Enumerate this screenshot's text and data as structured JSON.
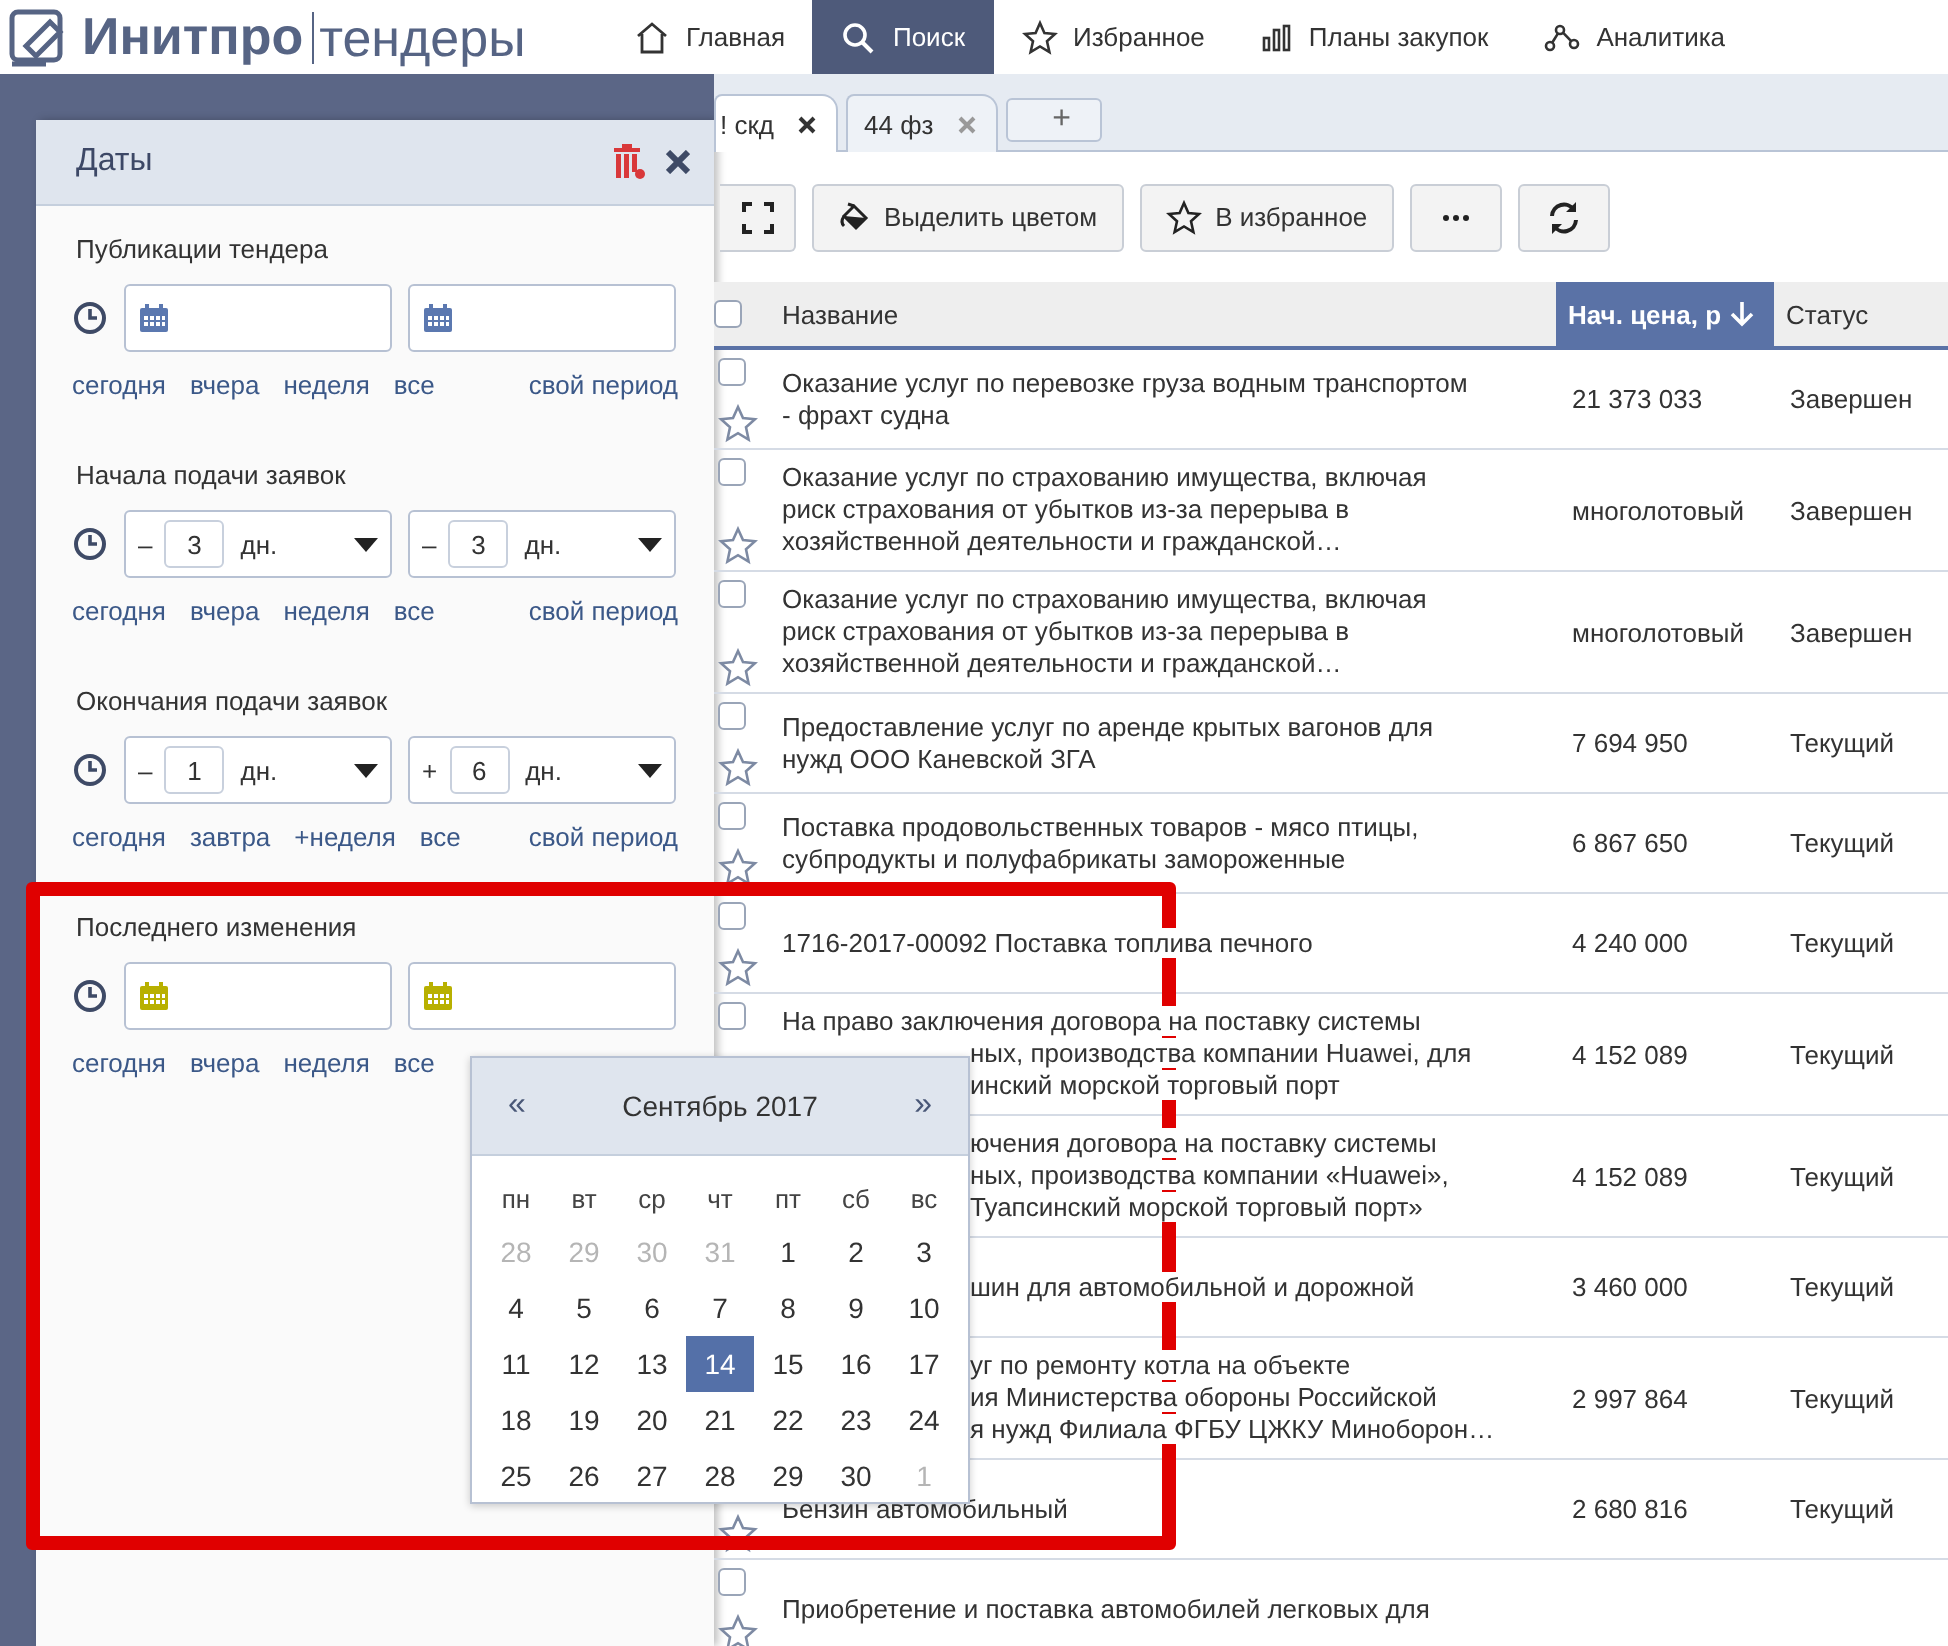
{
  "logo": {
    "brand": "Инитпро",
    "product": "тендеры"
  },
  "nav": [
    {
      "label": "Главная",
      "selected": false
    },
    {
      "label": "Поиск",
      "selected": true
    },
    {
      "label": "Избранное",
      "selected": false
    },
    {
      "label": "Планы закупок",
      "selected": false
    },
    {
      "label": "Аналитика",
      "selected": false
    }
  ],
  "tabs": [
    {
      "label": "! скд",
      "selected": true
    },
    {
      "label": "44 фз",
      "selected": false
    }
  ],
  "add_tab": "+",
  "toolbar": [
    {
      "kind": "fullscreen"
    },
    {
      "kind": "color",
      "label": "Выделить цветом"
    },
    {
      "kind": "favorite",
      "label": "В избранное"
    },
    {
      "kind": "more"
    },
    {
      "kind": "refresh"
    }
  ],
  "table": {
    "header_checked": false,
    "columns": [
      {
        "label": "Название",
        "sorted": false
      },
      {
        "label": "Нач. цена, р",
        "sorted": true
      },
      {
        "label": "Статус",
        "sorted": false
      }
    ],
    "rows": [
      {
        "checked": false,
        "lines": [
          {
            "text": "Оказание услуг по перевозке груза водным транспортом",
            "cut": false
          },
          {
            "text": "- фрахт судна",
            "cut": false
          }
        ],
        "price": "21 373 033",
        "status": "Завершен"
      },
      {
        "checked": false,
        "lines": [
          {
            "text": "Оказание услуг по страхованию имущества, включая",
            "cut": false
          },
          {
            "text": "риск страхования от убытков из-за перерыва в",
            "cut": false
          },
          {
            "text": "хозяйственной деятельности и гражданской…",
            "cut": false
          }
        ],
        "price": "многолотовый",
        "status": "Завершен"
      },
      {
        "checked": false,
        "lines": [
          {
            "text": "Оказание услуг по страхованию имущества, включая",
            "cut": false
          },
          {
            "text": "риск страхования от убытков из-за перерыва в",
            "cut": false
          },
          {
            "text": "хозяйственной деятельности и гражданской…",
            "cut": false
          }
        ],
        "price": "многолотовый",
        "status": "Завершен"
      },
      {
        "checked": false,
        "lines": [
          {
            "text": "Предоставление услуг по аренде крытых вагонов для",
            "cut": false
          },
          {
            "text": "нужд ООО Каневской ЗГА",
            "cut": false
          }
        ],
        "price": "7 694 950",
        "status": "Текущий"
      },
      {
        "checked": false,
        "lines": [
          {
            "text": "Поставка продовольственных товаров - мясо птицы,",
            "cut": false
          },
          {
            "text": "субпродукты и полуфабрикаты замороженные",
            "cut": false
          }
        ],
        "price": "6 867 650",
        "status": "Текущий"
      },
      {
        "checked": false,
        "lines": [
          {
            "text": "1716-2017-00092 Поставка топлива печного",
            "cut": false
          }
        ],
        "price": "4 240 000",
        "status": "Текущий"
      },
      {
        "checked": false,
        "lines": [
          {
            "text": "На право заключения договора на поставку системы",
            "cut": false
          },
          {
            "text": "ных, производства компании Huawei, для",
            "cut": true
          },
          {
            "text": "инский морской торговый порт",
            "cut": true
          }
        ],
        "price": "4 152 089",
        "status": "Текущий"
      },
      {
        "lines": [
          {
            "text": "ючения договора на поставку системы",
            "cut": true
          },
          {
            "text": "ных, производства компании «Huawei»,",
            "cut": true
          },
          {
            "text": "Туапсинский морской торговый порт»",
            "cut": true
          }
        ],
        "price": "4 152 089",
        "status": "Текущий"
      },
      {
        "lines": [
          {
            "text": "шин для автомобильной и дорожной",
            "cut": true
          }
        ],
        "price": "3 460 000",
        "status": "Текущий"
      },
      {
        "lines": [
          {
            "text": "уг по ремонту котла на объекте",
            "cut": true
          },
          {
            "text": "ия Министерства обороны Российской",
            "cut": true
          },
          {
            "text": "я нужд Филиала ФГБУ ЦЖКУ Миноборон…",
            "cut": true
          }
        ],
        "price": "2 997 864",
        "status": "Текущий"
      },
      {
        "lines": [
          {
            "text": "Бензин автомобильный",
            "cut": false
          }
        ],
        "price": "2 680 816",
        "status": "Текущий"
      },
      {
        "checked": false,
        "lines": [
          {
            "text": "Приобретение и поставка автомобилей легковых для",
            "cut": false
          }
        ]
      }
    ]
  },
  "dates_panel": {
    "title": "Даты",
    "sections": [
      {
        "title": "Публикации тендера",
        "fields": [
          {
            "kind": "date",
            "active": false
          },
          {
            "kind": "date",
            "active": false
          }
        ],
        "links": [
          "сегодня",
          "вчера",
          "неделя",
          "все",
          "свой период"
        ]
      },
      {
        "title": "Начала подачи заявок",
        "fields": [
          {
            "kind": "relative",
            "sign": "–",
            "amount": "3",
            "unit": "дн."
          },
          {
            "kind": "relative",
            "sign": "–",
            "amount": "3",
            "unit": "дн."
          }
        ],
        "links": [
          "сегодня",
          "вчера",
          "неделя",
          "все",
          "свой период"
        ]
      },
      {
        "title": "Окончания подачи заявок",
        "fields": [
          {
            "kind": "relative",
            "sign": "–",
            "amount": "1",
            "unit": "дн."
          },
          {
            "kind": "relative",
            "sign": "+",
            "amount": "6",
            "unit": "дн."
          }
        ],
        "links": [
          "сегодня",
          "завтра",
          "+неделя",
          "все",
          "свой период"
        ]
      },
      {
        "title": "Последнего изменения",
        "fields": [
          {
            "kind": "date",
            "active": true
          },
          {
            "kind": "date",
            "active": true
          }
        ],
        "links": [
          "сегодня",
          "вчера",
          "неделя",
          "все"
        ]
      }
    ]
  },
  "calendar": {
    "prev": "«",
    "month": "Сентябрь 2017",
    "next": "»",
    "weekdays": [
      "пн",
      "вт",
      "ср",
      "чт",
      "пт",
      "сб",
      "вс"
    ],
    "days": [
      {
        "label": "28",
        "muted": true,
        "selected": false
      },
      {
        "label": "29",
        "muted": true,
        "selected": false
      },
      {
        "label": "30",
        "muted": true,
        "selected": false
      },
      {
        "label": "31",
        "muted": true,
        "selected": false
      },
      {
        "label": "1",
        "muted": false,
        "selected": false
      },
      {
        "label": "2",
        "muted": false,
        "selected": false
      },
      {
        "label": "3",
        "muted": false,
        "selected": false
      },
      {
        "label": "4",
        "muted": false,
        "selected": false
      },
      {
        "label": "5",
        "muted": false,
        "selected": false
      },
      {
        "label": "6",
        "muted": false,
        "selected": false
      },
      {
        "label": "7",
        "muted": false,
        "selected": false
      },
      {
        "label": "8",
        "muted": false,
        "selected": false
      },
      {
        "label": "9",
        "muted": false,
        "selected": false
      },
      {
        "label": "10",
        "muted": false,
        "selected": false
      },
      {
        "label": "11",
        "muted": false,
        "selected": false
      },
      {
        "label": "12",
        "muted": false,
        "selected": false
      },
      {
        "label": "13",
        "muted": false,
        "selected": false
      },
      {
        "label": "14",
        "muted": false,
        "selected": true
      },
      {
        "label": "15",
        "muted": false,
        "selected": false
      },
      {
        "label": "16",
        "muted": false,
        "selected": false
      },
      {
        "label": "17",
        "muted": false,
        "selected": false
      },
      {
        "label": "18",
        "muted": false,
        "selected": false
      },
      {
        "label": "19",
        "muted": false,
        "selected": false
      },
      {
        "label": "20",
        "muted": false,
        "selected": false
      },
      {
        "label": "21",
        "muted": false,
        "selected": false
      },
      {
        "label": "22",
        "muted": false,
        "selected": false
      },
      {
        "label": "23",
        "muted": false,
        "selected": false
      },
      {
        "label": "24",
        "muted": false,
        "selected": false
      },
      {
        "label": "25",
        "muted": false,
        "selected": false
      },
      {
        "label": "26",
        "muted": false,
        "selected": false
      },
      {
        "label": "27",
        "muted": false,
        "selected": false
      },
      {
        "label": "28",
        "muted": false,
        "selected": false
      },
      {
        "label": "29",
        "muted": false,
        "selected": false
      },
      {
        "label": "30",
        "muted": false,
        "selected": false
      },
      {
        "label": "1",
        "muted": true,
        "selected": false
      }
    ]
  }
}
